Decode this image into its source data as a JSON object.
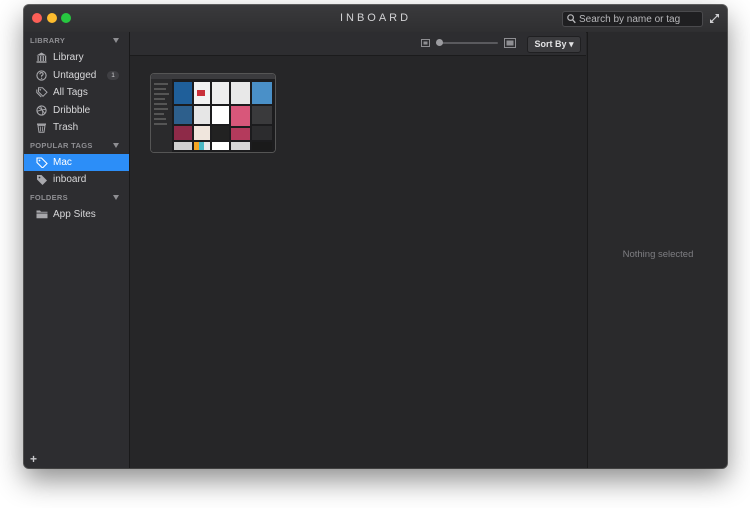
{
  "window": {
    "title": "INBOARD"
  },
  "search": {
    "placeholder": "Search by name or tag"
  },
  "sidebar": {
    "sections": [
      {
        "label": "LIBRARY",
        "items": [
          {
            "label": "Library",
            "icon": "library-icon"
          },
          {
            "label": "Untagged",
            "icon": "question-icon",
            "badge": "1"
          },
          {
            "label": "All Tags",
            "icon": "tags-icon"
          },
          {
            "label": "Dribbble",
            "icon": "dribbble-icon"
          },
          {
            "label": "Trash",
            "icon": "trash-icon"
          }
        ]
      },
      {
        "label": "POPULAR TAGS",
        "items": [
          {
            "label": "Mac",
            "icon": "tag-icon",
            "selected": true
          },
          {
            "label": "inboard",
            "icon": "tag-icon"
          }
        ]
      },
      {
        "label": "FOLDERS",
        "items": [
          {
            "label": "App Sites",
            "icon": "folder-icon"
          }
        ]
      }
    ],
    "add_label": "+"
  },
  "toolbar": {
    "sort_label": "Sort By ▾",
    "zoom_level": 0.05
  },
  "detail": {
    "empty_text": "Nothing selected"
  },
  "colors": {
    "accent": "#2c8ef8",
    "window_bg": "#262628",
    "sidebar_bg": "#2d2d30"
  }
}
